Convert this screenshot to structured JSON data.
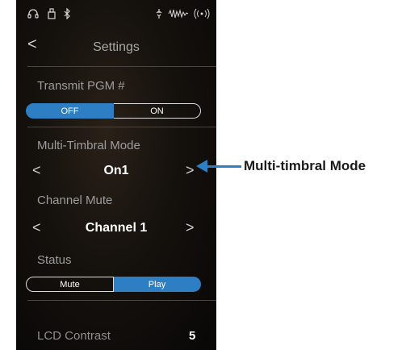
{
  "status_bar": {
    "icons": [
      "headphones-icon",
      "usb-icon",
      "bluetooth-icon",
      "metronome-icon",
      "wave-icon",
      "wireless-icon"
    ]
  },
  "header": {
    "back_glyph": "<",
    "title": "Settings"
  },
  "transmit_pgm": {
    "label": "Transmit PGM #",
    "options": [
      "OFF",
      "ON"
    ],
    "selected": "OFF"
  },
  "multi_timbral": {
    "label": "Multi-Timbral Mode",
    "value": "On1",
    "prev_glyph": "<",
    "next_glyph": ">"
  },
  "channel_mute": {
    "label": "Channel Mute",
    "value": "Channel 1",
    "prev_glyph": "<",
    "next_glyph": ">"
  },
  "status": {
    "label": "Status",
    "options": [
      "Mute",
      "Play"
    ],
    "selected": "Play"
  },
  "lcd_contrast": {
    "label": "LCD Contrast",
    "value": "5"
  },
  "callout": {
    "text": "Multi-timbral Mode"
  },
  "colors": {
    "accent": "#2d7ec2",
    "background": "#15110d"
  }
}
